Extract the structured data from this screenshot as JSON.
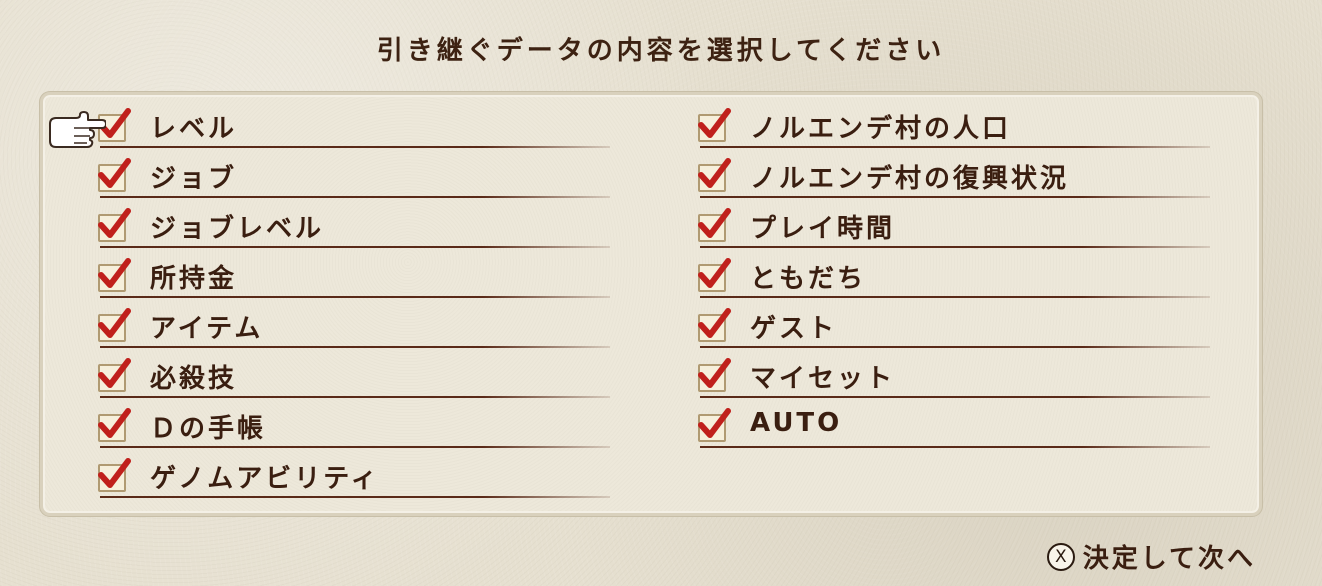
{
  "title": "引き継ぐデータの内容を選択してください",
  "left_items": [
    {
      "label": "レベル",
      "checked": true
    },
    {
      "label": "ジョブ",
      "checked": true
    },
    {
      "label": "ジョブレベル",
      "checked": true
    },
    {
      "label": "所持金",
      "checked": true
    },
    {
      "label": "アイテム",
      "checked": true
    },
    {
      "label": "必殺技",
      "checked": true
    },
    {
      "label": "Ｄの手帳",
      "checked": true
    },
    {
      "label": "ゲノムアビリティ",
      "checked": true
    }
  ],
  "right_items": [
    {
      "label": "ノルエンデ村の人口",
      "checked": true
    },
    {
      "label": "ノルエンデ村の復興状況",
      "checked": true
    },
    {
      "label": "プレイ時間",
      "checked": true
    },
    {
      "label": "ともだち",
      "checked": true
    },
    {
      "label": "ゲスト",
      "checked": true
    },
    {
      "label": "マイセット",
      "checked": true
    },
    {
      "label": "AUTO",
      "checked": true
    }
  ],
  "footer": {
    "button_glyph": "X",
    "label": "決定して次へ"
  },
  "colors": {
    "check": "#c0201c",
    "text": "#3a1e10",
    "line": "#5a2a18"
  },
  "icons": {
    "cursor": "pointing-hand-icon",
    "check": "checkmark-icon",
    "confirm": "x-button-icon"
  }
}
